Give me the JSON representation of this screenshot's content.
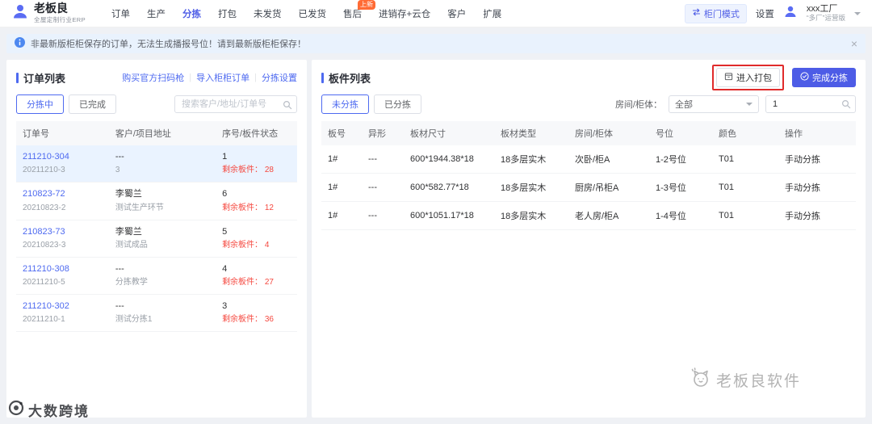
{
  "icons": {
    "close": "×"
  },
  "app": {
    "logo_title": "老板良",
    "logo_subtitle": "全屋定制行业ERP",
    "nav": [
      {
        "label": "订单"
      },
      {
        "label": "生产"
      },
      {
        "label": "分拣"
      },
      {
        "label": "打包"
      },
      {
        "label": "未发货"
      },
      {
        "label": "已发货"
      },
      {
        "label": "售后",
        "badge": "上新"
      },
      {
        "label": "进销存+云仓"
      },
      {
        "label": "客户"
      },
      {
        "label": "扩展"
      }
    ],
    "cabinet_mode_label": "柜门模式",
    "settings_label": "设置",
    "factory_name": "xxx工厂",
    "factory_edition": "“多厂”运营版"
  },
  "notice": {
    "text": "非最新版柜柜保存的订单，无法生成播报号位！请到最新版柜柜保存！"
  },
  "orders_panel": {
    "title": "订单列表",
    "links": {
      "buy_scanner": "购买官方扫码枪",
      "import_orders": "导入柜柜订单",
      "sorting_settings": "分拣设置"
    },
    "tabs": {
      "sorting": "分拣中",
      "completed": "已完成"
    },
    "search_placeholder": "搜索客户/地址/订单号",
    "columns": [
      "订单号",
      "客户/项目地址",
      "序号/板件状态"
    ],
    "rows": [
      {
        "order_no": "211210-304",
        "order_sub": "20211210-3",
        "customer": "---",
        "address": "3",
        "seq": "1",
        "remain_text": "剩余板件： 28"
      },
      {
        "order_no": "210823-72",
        "order_sub": "20210823-2",
        "customer": "李蜀兰",
        "address": "测试生产环节",
        "seq": "6",
        "remain_text": "剩余板件： 12"
      },
      {
        "order_no": "210823-73",
        "order_sub": "20210823-3",
        "customer": "李蜀兰",
        "address": "测试成品",
        "seq": "5",
        "remain_text": "剩余板件： 4"
      },
      {
        "order_no": "211210-308",
        "order_sub": "20211210-5",
        "customer": "---",
        "address": "分拣教学",
        "seq": "4",
        "remain_text": "剩余板件： 27"
      },
      {
        "order_no": "211210-302",
        "order_sub": "20211210-1",
        "customer": "---",
        "address": "测试分拣1",
        "seq": "3",
        "remain_text": "剩余板件： 36"
      }
    ]
  },
  "board_panel": {
    "title": "板件列表",
    "enter_pack_label": "进入打包",
    "finish_sort_label": "完成分拣",
    "tabs": {
      "unsorted": "未分拣",
      "sorted": "已分拣"
    },
    "filter_label": "房间/柜体：",
    "filter_value": "全部",
    "board_search_value": "1",
    "columns": [
      "板号",
      "异形",
      "板材尺寸",
      "板材类型",
      "房间/柜体",
      "号位",
      "颜色",
      "操作"
    ],
    "rows": [
      {
        "board_no": "1#",
        "irregular": "---",
        "size": "600*1944.38*18",
        "material": "18多层实木",
        "room": "次卧/柜A",
        "position": "1-2号位",
        "color": "T01",
        "action": "手动分拣"
      },
      {
        "board_no": "1#",
        "irregular": "---",
        "size": "600*582.77*18",
        "material": "18多层实木",
        "room": "厨房/吊柜A",
        "position": "1-3号位",
        "color": "T01",
        "action": "手动分拣"
      },
      {
        "board_no": "1#",
        "irregular": "---",
        "size": "600*1051.17*18",
        "material": "18多层实木",
        "room": "老人房/柜A",
        "position": "1-4号位",
        "color": "T01",
        "action": "手动分拣"
      }
    ]
  },
  "watermarks": {
    "bottom_left": "大数跨境",
    "bottom_right": "老板良软件"
  },
  "colors": {
    "accent": "#4d5ce6",
    "link": "#4e6af0",
    "danger": "#f5483f",
    "annotation": "#e02b2b",
    "badge": "#ff6b35"
  }
}
